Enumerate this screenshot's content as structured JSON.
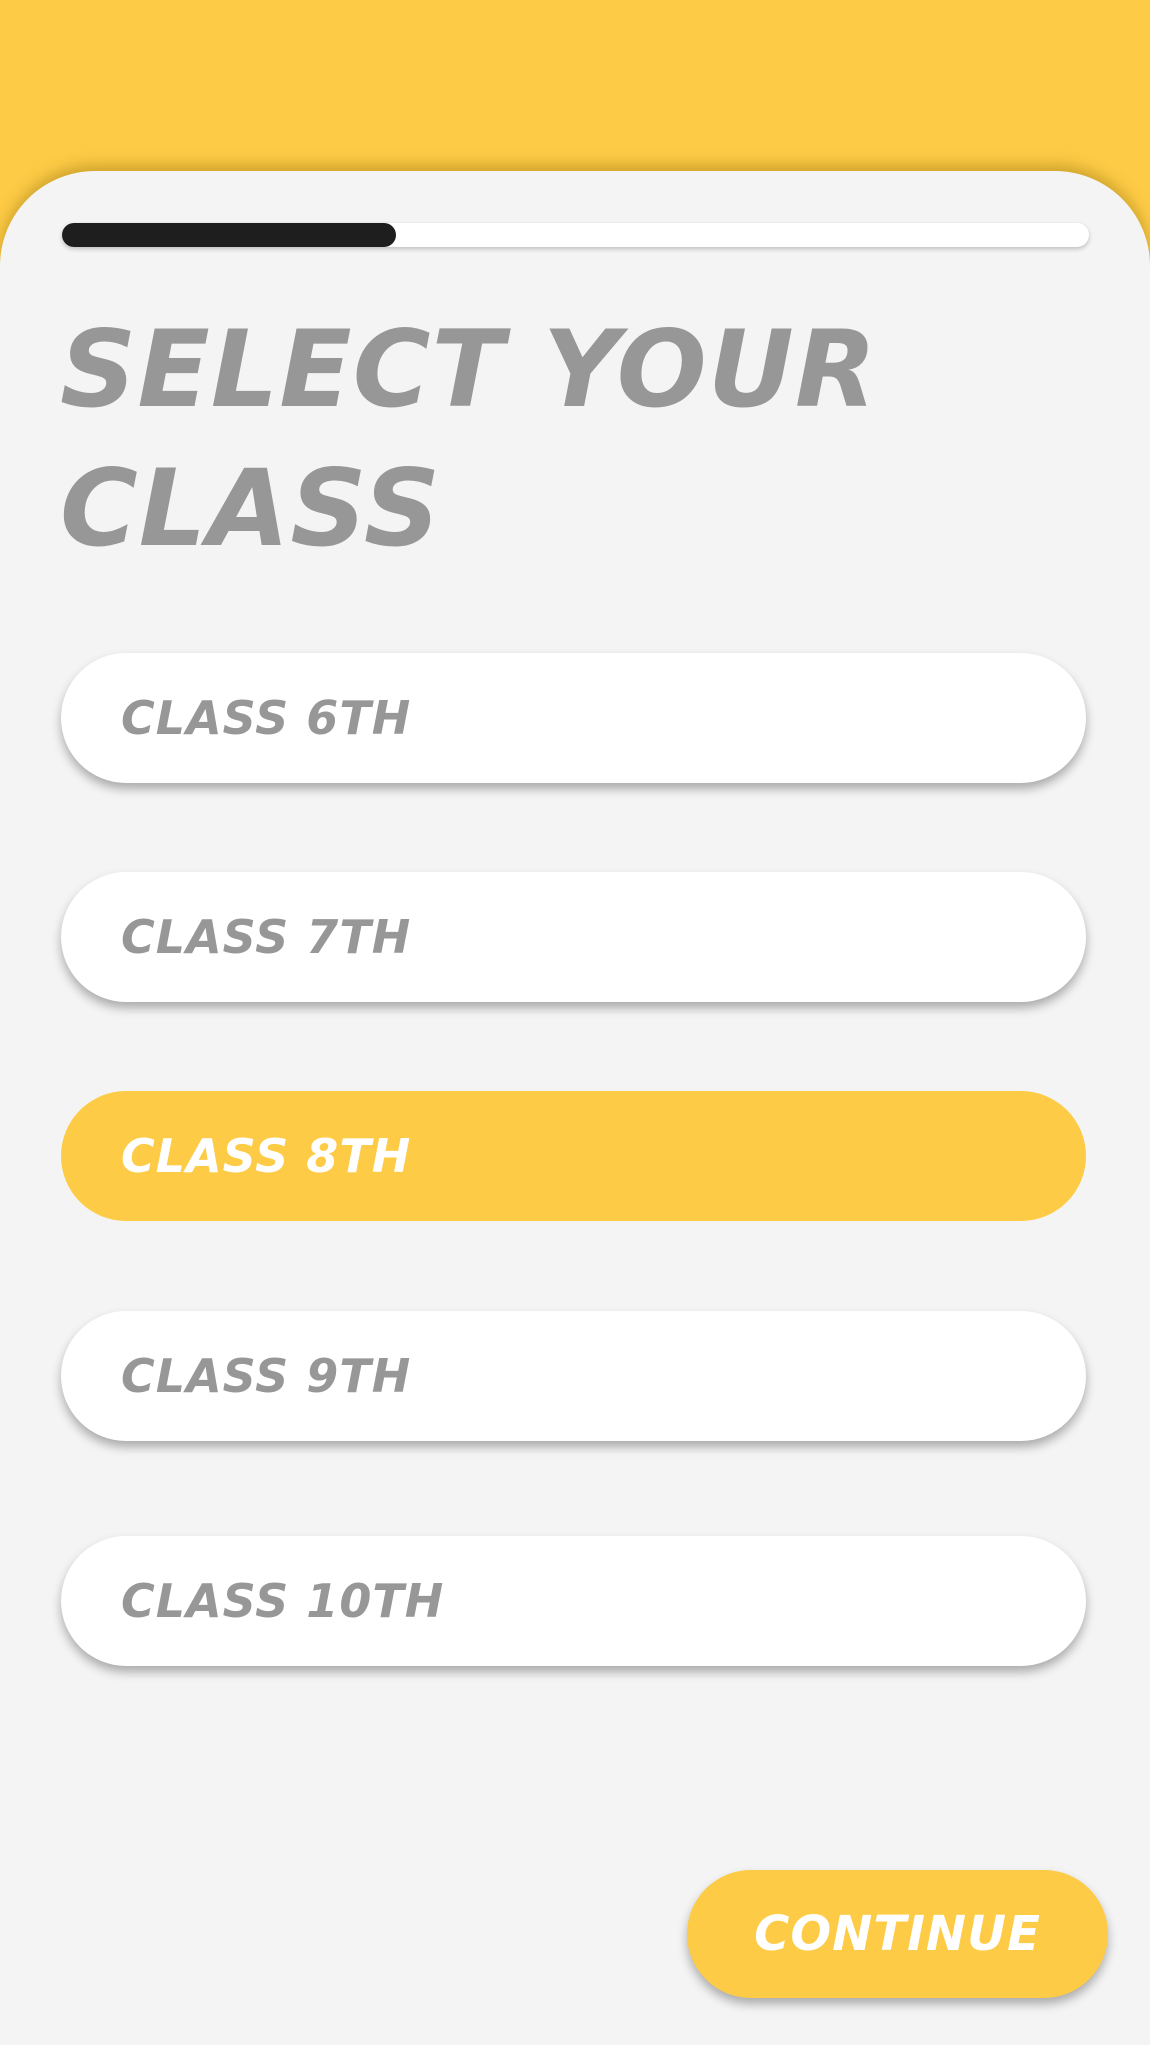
{
  "progress": {
    "value": 0.325,
    "fill_color": "#1E1E1E",
    "track_color": "#FFFFFF"
  },
  "colors": {
    "accent": "#FDCB45",
    "background": "#F4F4F4",
    "text_muted": "#979797"
  },
  "title": "SELECT YOUR CLASS",
  "options": [
    {
      "label": "CLASS 6TH",
      "selected": false
    },
    {
      "label": "CLASS 7TH",
      "selected": false
    },
    {
      "label": "CLASS 8TH",
      "selected": true
    },
    {
      "label": "CLASS 9TH",
      "selected": false
    },
    {
      "label": "CLASS 10TH",
      "selected": false
    }
  ],
  "continue_label": "CONTINUE"
}
